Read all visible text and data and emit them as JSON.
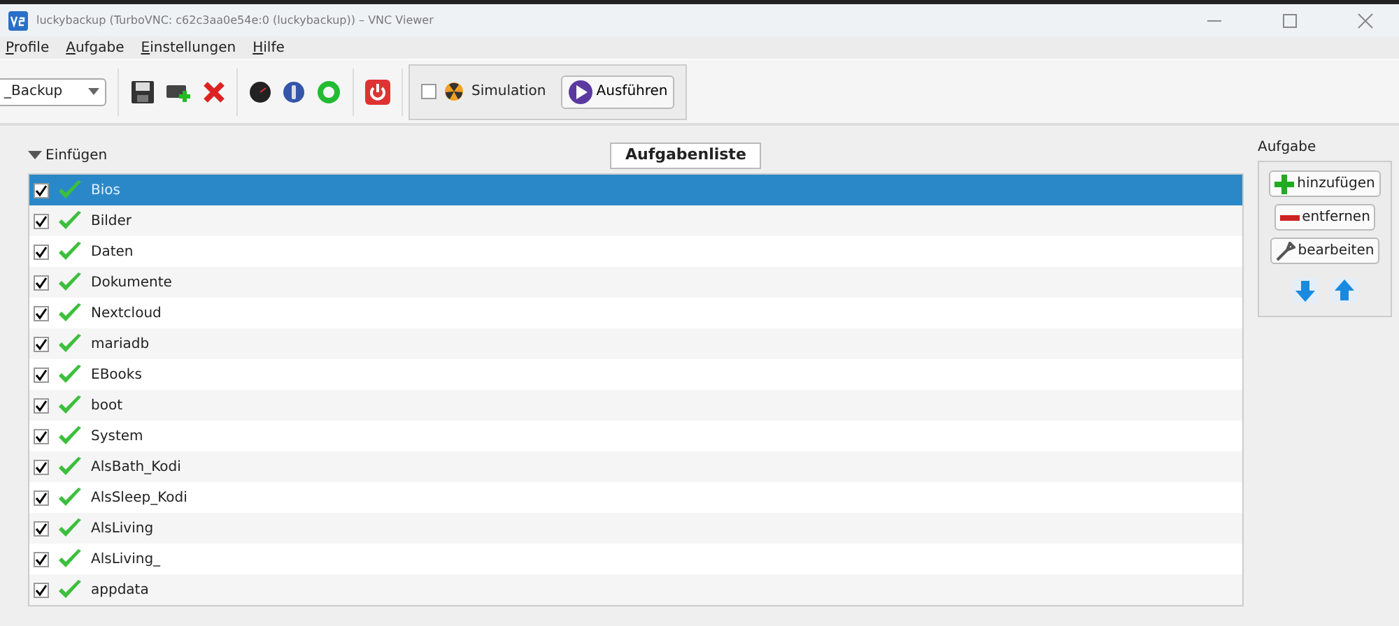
{
  "window": {
    "title": "luckybackup (TurboVNC: c62c3aa0e54e:0 (luckybackup)) – VNC Viewer"
  },
  "menu": [
    {
      "label": "Profile"
    },
    {
      "label": "Aufgabe"
    },
    {
      "label": "Einstellungen"
    },
    {
      "label": "Hilfe"
    }
  ],
  "toolbar": {
    "profile": "_Backup",
    "simulation": {
      "label": "Simulation",
      "checked": false
    },
    "run": "Ausführen"
  },
  "insert": {
    "label": "Einfügen",
    "expanded": true
  },
  "list_title": "Aufgabenliste",
  "tasks": [
    {
      "name": "Bios",
      "checked": true,
      "selected": true
    },
    {
      "name": "Bilder",
      "checked": true,
      "selected": false
    },
    {
      "name": "Daten",
      "checked": true,
      "selected": false
    },
    {
      "name": "Dokumente",
      "checked": true,
      "selected": false
    },
    {
      "name": "Nextcloud",
      "checked": true,
      "selected": false
    },
    {
      "name": "mariadb",
      "checked": true,
      "selected": false
    },
    {
      "name": "EBooks",
      "checked": true,
      "selected": false
    },
    {
      "name": "boot",
      "checked": true,
      "selected": false
    },
    {
      "name": "System",
      "checked": true,
      "selected": false
    },
    {
      "name": "AlsBath_Kodi",
      "checked": true,
      "selected": false
    },
    {
      "name": "AlsSleep_Kodi",
      "checked": true,
      "selected": false
    },
    {
      "name": "AlsLiving",
      "checked": true,
      "selected": false
    },
    {
      "name": "AlsLiving_",
      "checked": true,
      "selected": false
    },
    {
      "name": "appdata",
      "checked": true,
      "selected": false
    }
  ],
  "task_panel": {
    "title": "Aufgabe",
    "buttons": [
      {
        "kind": "add",
        "label": "hinzufügen"
      },
      {
        "kind": "remove",
        "label": "entfernen"
      },
      {
        "kind": "edit",
        "label": "bearbeiten"
      }
    ]
  }
}
